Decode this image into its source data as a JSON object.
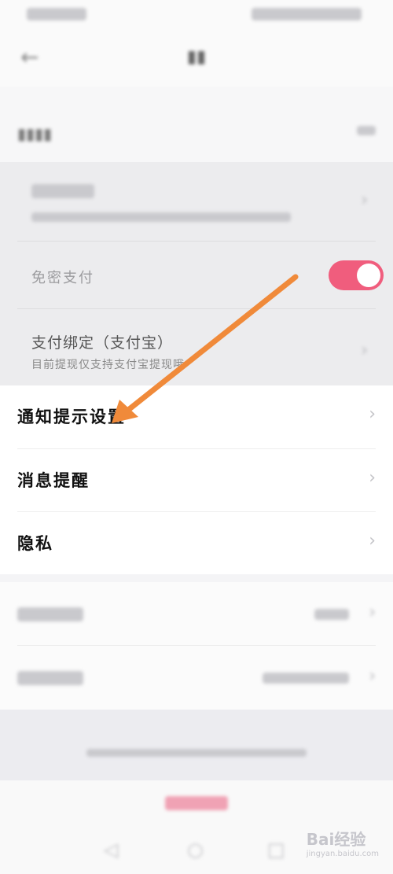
{
  "rows": {
    "password_free": "免密支付",
    "bind_title": "支付绑定（支付宝）",
    "bind_desc": "目前提现仅支持支付宝提现哦",
    "notify": "通知提示设置",
    "message": "消息提醒",
    "privacy": "隐私"
  },
  "toggle": {
    "password_free_on": true
  },
  "colors": {
    "toggle_on": "#f05d7d",
    "arrow": "#f08a3a"
  },
  "watermark": "Bai经验",
  "watermark_sub": "jingyan.baidu.com",
  "icons": [
    "back-arrow-icon",
    "chevron-right-icon",
    "nav-back-icon",
    "nav-home-icon",
    "nav-recent-icon"
  ]
}
